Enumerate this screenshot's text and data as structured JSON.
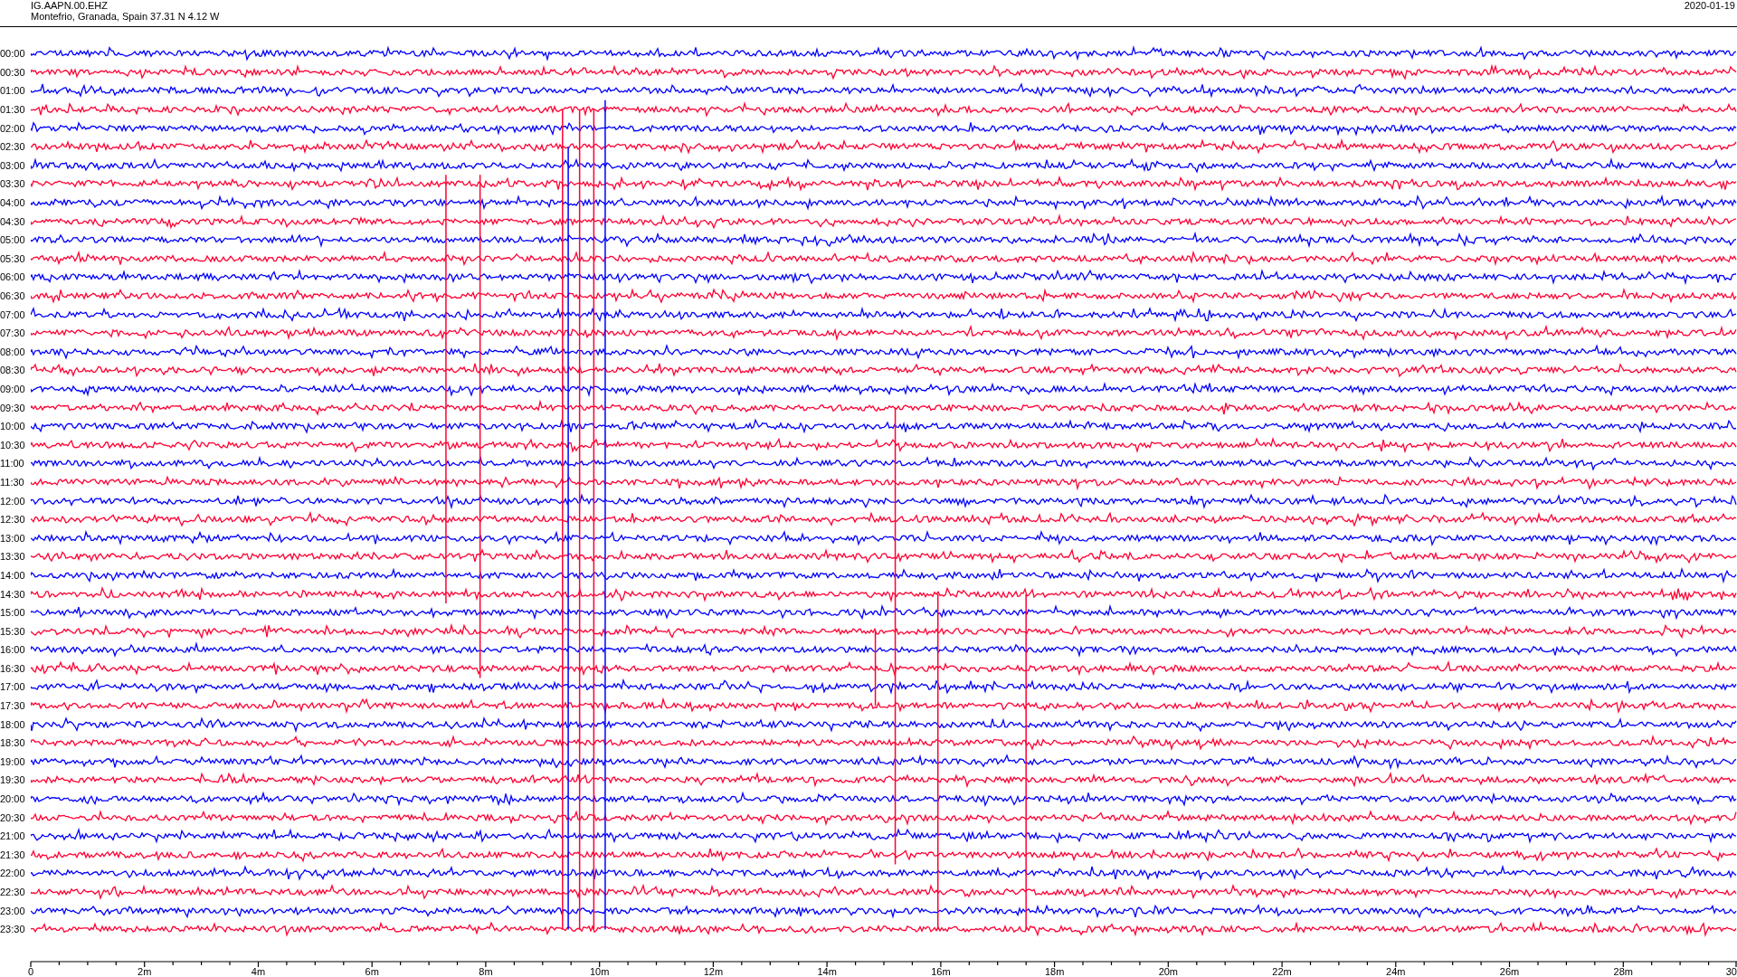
{
  "header": {
    "station": "IG.AAPN.00.EHZ",
    "location": "Montefrio, Granada, Spain  37.31 N 4.12 W",
    "date": "2020-01-19"
  },
  "traces": [
    {
      "label": "00:00",
      "color": "#0000ff"
    },
    {
      "label": "00:30",
      "color": "#ff0033"
    },
    {
      "label": "01:00",
      "color": "#0000ff"
    },
    {
      "label": "01:30",
      "color": "#ff0033"
    },
    {
      "label": "02:00",
      "color": "#0000ff"
    },
    {
      "label": "02:30",
      "color": "#ff0033"
    },
    {
      "label": "03:00",
      "color": "#0000ff"
    },
    {
      "label": "03:30",
      "color": "#ff0033"
    },
    {
      "label": "04:00",
      "color": "#0000ff"
    },
    {
      "label": "04:30",
      "color": "#ff0033"
    },
    {
      "label": "05:00",
      "color": "#0000ff"
    },
    {
      "label": "05:30",
      "color": "#ff0033"
    },
    {
      "label": "06:00",
      "color": "#0000ff"
    },
    {
      "label": "06:30",
      "color": "#ff0033"
    },
    {
      "label": "07:00",
      "color": "#0000ff"
    },
    {
      "label": "07:30",
      "color": "#ff0033"
    },
    {
      "label": "08:00",
      "color": "#0000ff"
    },
    {
      "label": "08:30",
      "color": "#ff0033"
    },
    {
      "label": "09:00",
      "color": "#0000ff"
    },
    {
      "label": "09:30",
      "color": "#ff0033"
    },
    {
      "label": "10:00",
      "color": "#0000ff"
    },
    {
      "label": "10:30",
      "color": "#ff0033"
    },
    {
      "label": "11:00",
      "color": "#0000ff"
    },
    {
      "label": "11:30",
      "color": "#ff0033"
    },
    {
      "label": "12:00",
      "color": "#0000ff"
    },
    {
      "label": "12:30",
      "color": "#ff0033"
    },
    {
      "label": "13:00",
      "color": "#0000ff"
    },
    {
      "label": "13:30",
      "color": "#ff0033"
    },
    {
      "label": "14:00",
      "color": "#0000ff"
    },
    {
      "label": "14:30",
      "color": "#ff0033"
    },
    {
      "label": "15:00",
      "color": "#0000ff"
    },
    {
      "label": "15:30",
      "color": "#ff0033"
    },
    {
      "label": "16:00",
      "color": "#0000ff"
    },
    {
      "label": "16:30",
      "color": "#ff0033"
    },
    {
      "label": "17:00",
      "color": "#0000ff"
    },
    {
      "label": "17:30",
      "color": "#ff0033"
    },
    {
      "label": "18:00",
      "color": "#0000ff"
    },
    {
      "label": "18:30",
      "color": "#ff0033"
    },
    {
      "label": "19:00",
      "color": "#0000ff"
    },
    {
      "label": "19:30",
      "color": "#ff0033"
    },
    {
      "label": "20:00",
      "color": "#0000ff"
    },
    {
      "label": "20:30",
      "color": "#ff0033"
    },
    {
      "label": "21:00",
      "color": "#0000ff"
    },
    {
      "label": "21:30",
      "color": "#ff0033"
    },
    {
      "label": "22:00",
      "color": "#0000ff"
    },
    {
      "label": "22:30",
      "color": "#ff0033"
    },
    {
      "label": "23:00",
      "color": "#0000ff"
    },
    {
      "label": "23:30",
      "color": "#ff0033"
    }
  ],
  "x_axis": {
    "labels": [
      "0",
      "2m",
      "4m",
      "6m",
      "8m",
      "10m",
      "12m",
      "14m",
      "16m",
      "18m",
      "20m",
      "22m",
      "24m",
      "26m",
      "28m",
      "30"
    ]
  }
}
